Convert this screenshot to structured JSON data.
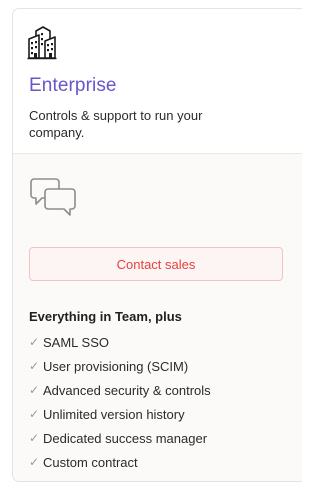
{
  "plan": {
    "name": "Enterprise",
    "description": "Controls & support to run your company.",
    "icon": "office-buildings-icon",
    "accent_color": "#6a55c9"
  },
  "contact": {
    "icon": "chat-bubbles-icon",
    "button_label": "Contact sales",
    "button_color": "#e4433f"
  },
  "features": {
    "heading": "Everything in Team, plus",
    "check_glyph": "✓",
    "items": [
      {
        "label": "SAML SSO"
      },
      {
        "label": "User provisioning (SCIM)"
      },
      {
        "label": "Advanced security & controls"
      },
      {
        "label": "Unlimited version history"
      },
      {
        "label": "Dedicated success manager"
      },
      {
        "label": "Custom contract"
      }
    ]
  }
}
